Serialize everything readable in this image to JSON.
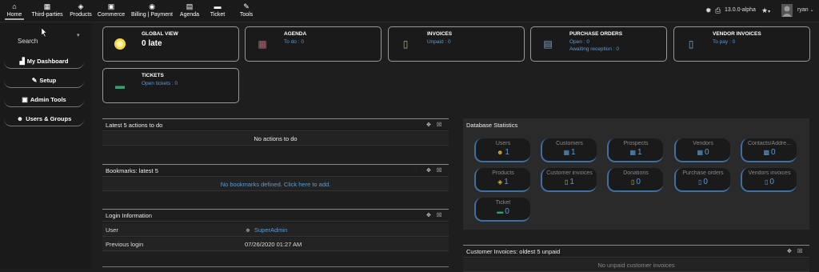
{
  "topbar": {
    "menu": [
      {
        "label": "Home",
        "icon": "home-icon",
        "glyph": "⌂"
      },
      {
        "label": "Third-parties",
        "icon": "building-icon",
        "glyph": "▦"
      },
      {
        "label": "Products",
        "icon": "cube-icon",
        "glyph": "◈"
      },
      {
        "label": "Commerce",
        "icon": "briefcase-icon",
        "glyph": "▣"
      },
      {
        "label": "Billing | Payment",
        "icon": "coins-icon",
        "glyph": "◉"
      },
      {
        "label": "Agenda",
        "icon": "calendar-icon",
        "glyph": "▤"
      },
      {
        "label": "Ticket",
        "icon": "ticket-icon",
        "glyph": "▬"
      },
      {
        "label": "Tools",
        "icon": "wrench-icon",
        "glyph": "✎"
      }
    ],
    "version": "13.0.0-alpha",
    "username": "ryan"
  },
  "sidebar": {
    "search_label": "Search",
    "buttons": [
      {
        "label": "My Dashboard",
        "icon": "chart-icon",
        "glyph": "▟"
      },
      {
        "label": "Setup",
        "icon": "wrench-icon",
        "glyph": "✎"
      },
      {
        "label": "Admin Tools",
        "icon": "briefcase-icon",
        "glyph": "▣"
      },
      {
        "label": "Users & Groups",
        "icon": "users-icon",
        "glyph": "☻"
      }
    ]
  },
  "boxes": {
    "global": {
      "title": "GLOBAL VIEW",
      "value": "0 late"
    },
    "agenda": {
      "title": "AGENDA",
      "line1": "To do : 0"
    },
    "invoices": {
      "title": "INVOICES",
      "line1": "Unpaid : 0"
    },
    "purchase": {
      "title": "PURCHASE ORDERS",
      "line1": "Open : 0",
      "line2": "Awaiting reception : 0"
    },
    "vendor": {
      "title": "VENDOR INVOICES",
      "line1": "To pay : 0"
    },
    "tickets": {
      "title": "TICKETS",
      "line1": "Open tickets : 0"
    }
  },
  "panels": {
    "actions": {
      "title": "Latest 5 actions to do",
      "empty": "No actions to do"
    },
    "bookmarks": {
      "title": "Bookmarks: latest 5",
      "empty": "No bookmarks defined. Click here to add."
    },
    "login": {
      "title": "Login Information",
      "user_label": "User",
      "user_value": "SuperAdmin",
      "prev_label": "Previous login",
      "prev_value": "07/26/2020 01:27 AM"
    },
    "stats": {
      "title": "Database Statistics",
      "items": [
        {
          "label": "Users",
          "value": "1",
          "icon": "user-icon",
          "glyph": "☻",
          "color": "#d9a441"
        },
        {
          "label": "Customers",
          "value": "1",
          "icon": "building-icon",
          "glyph": "▦",
          "color": "#5b9bd5"
        },
        {
          "label": "Prospects",
          "value": "1",
          "icon": "building-icon",
          "glyph": "▦",
          "color": "#5b9bd5"
        },
        {
          "label": "Vendors",
          "value": "0",
          "icon": "building-icon",
          "glyph": "▦",
          "color": "#5b9bd5"
        },
        {
          "label": "Contacts/Addre...",
          "value": "0",
          "icon": "contact-icon",
          "glyph": "▩",
          "color": "#5b9bd5"
        },
        {
          "label": "Products",
          "value": "1",
          "icon": "cube-icon",
          "glyph": "◈",
          "color": "#d9b441"
        },
        {
          "label": "Customer invoices",
          "value": "1",
          "icon": "invoice-icon",
          "glyph": "▯",
          "color": "#a9b47a"
        },
        {
          "label": "Donations",
          "value": "0",
          "icon": "donation-icon",
          "glyph": "▯",
          "color": "#a9b47a"
        },
        {
          "label": "Purchase orders",
          "value": "0",
          "icon": "order-icon",
          "glyph": "▯",
          "color": "#5b9bd5"
        },
        {
          "label": "Vendors invoices",
          "value": "0",
          "icon": "invoice-icon",
          "glyph": "▯",
          "color": "#5b9bd5"
        },
        {
          "label": "Ticket",
          "value": "0",
          "icon": "ticket-icon",
          "glyph": "▬",
          "color": "#2fa36b"
        }
      ]
    },
    "cust_invoices": {
      "title": "Customer Invoices: oldest 5 unpaid",
      "empty": "No unpaid customer invoices"
    }
  }
}
